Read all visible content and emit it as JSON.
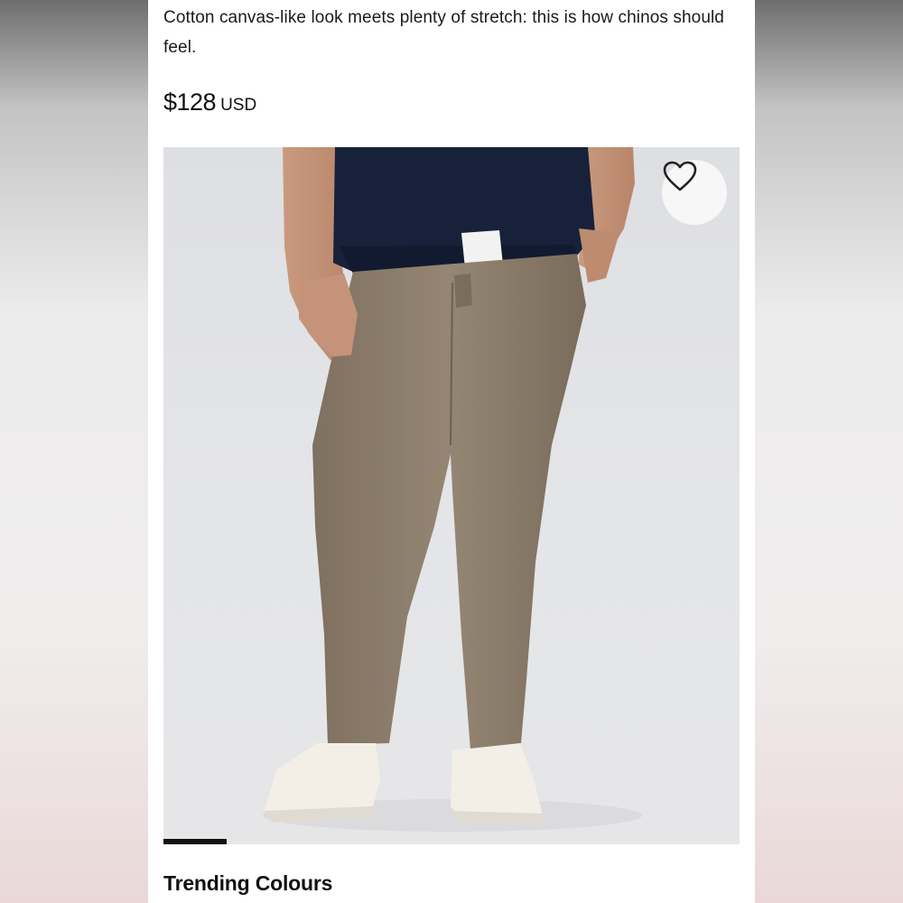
{
  "product": {
    "description": "Cotton canvas-like look meets plenty of stretch: this is how chinos should feel.",
    "price": "$128",
    "currency": "USD"
  },
  "gallery": {
    "wishlist_icon": "heart-outline-icon",
    "slide_indicator": {
      "active_fraction": 0.11
    }
  },
  "sections": {
    "trending_title": "Trending Colours"
  },
  "colors": {
    "pants": "#8d7e6c",
    "shirt": "#17213a",
    "background_photo": "#e3e4e7",
    "text": "#111111"
  }
}
